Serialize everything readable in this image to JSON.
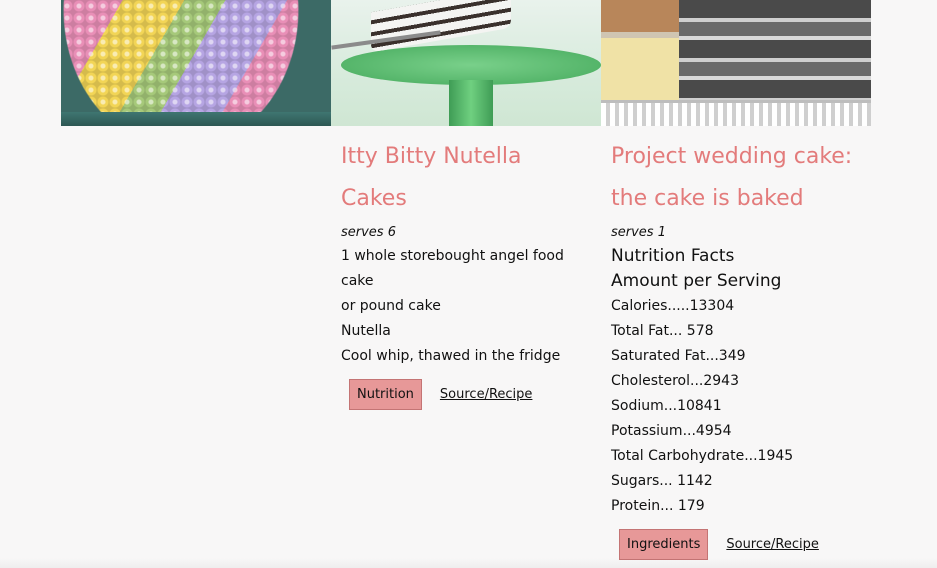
{
  "cards": [
    {
      "image": "candy-covered-cake"
    },
    {
      "image": "cake-on-green-cake-stand",
      "title": "Itty Bitty Nutella Cakes",
      "serves": "serves 6",
      "lines": [
        "1 whole storebought angel food cake",
        "or pound cake",
        "Nutella",
        "Cool whip, thawed in the fridge"
      ],
      "button_label": "Nutrition",
      "link_label": "Source/Recipe"
    },
    {
      "image": "baked-cakes-in-pans",
      "title_line1": "Project wedding cake:",
      "title_line2": "the cake is baked",
      "serves": "serves 1",
      "facts_title": "Nutrition Facts",
      "facts_subtitle": "Amount per Serving",
      "facts": [
        "Calories.....13304",
        "Total Fat... 578",
        "Saturated Fat...349",
        "Cholesterol...2943",
        "Sodium...10841",
        "Potassium...4954",
        "Total Carbohydrate...1945",
        "Sugars... 1142",
        "Protein... 179"
      ],
      "button_label": "Ingredients",
      "link_label": "Source/Recipe"
    }
  ],
  "colors": {
    "title": "#e37b7b",
    "button": "#e79898",
    "background": "#f8f7f7"
  }
}
